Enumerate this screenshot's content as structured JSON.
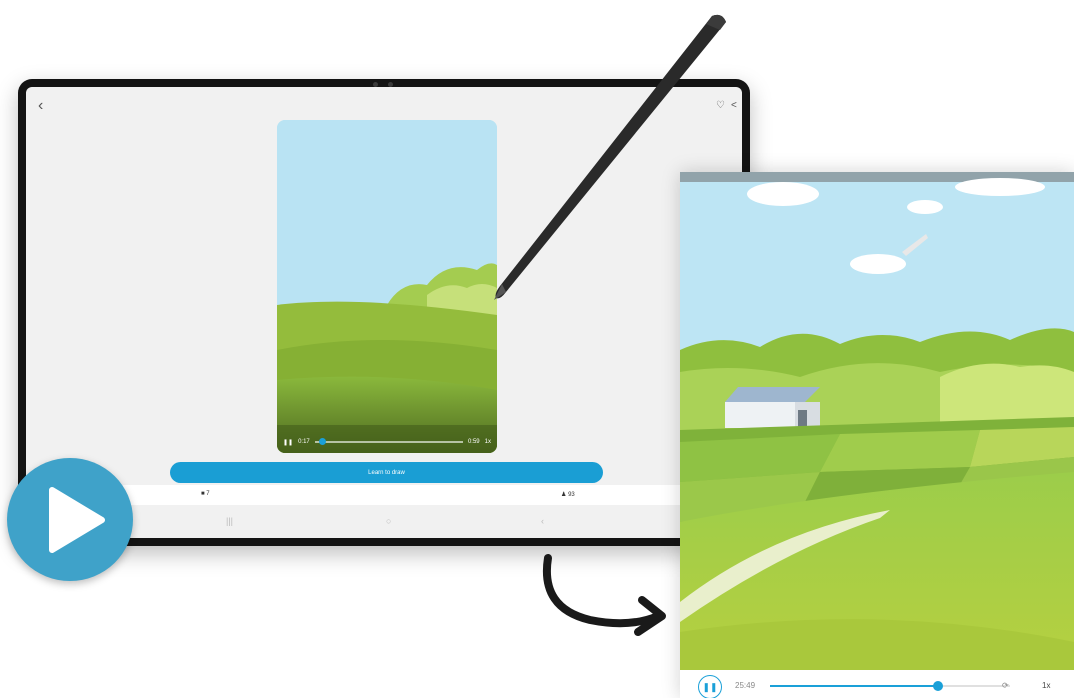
{
  "tablet": {
    "back_icon": "‹",
    "heart_icon": "♡",
    "share_icon": "<",
    "mini_player": {
      "pause_icon": "❚❚",
      "time": "0:17",
      "end_time": "0:59",
      "speed": "1x",
      "progress": 0.03
    },
    "learn_button": "Learn to draw",
    "comments_count": "7",
    "people_count": "93",
    "nav": {
      "recents": "|||",
      "home": "○",
      "back": "‹"
    }
  },
  "play_overlay": {
    "icon": "play-icon"
  },
  "zoom_player": {
    "pause_icon": "❚❚",
    "time": "25:49",
    "step_icon": "⟳",
    "speed": "1x",
    "progress": 0.7
  },
  "colors": {
    "accent": "#1a9ed4",
    "play_circle": "#3fa2c9",
    "sky": "#b9e3f3"
  }
}
